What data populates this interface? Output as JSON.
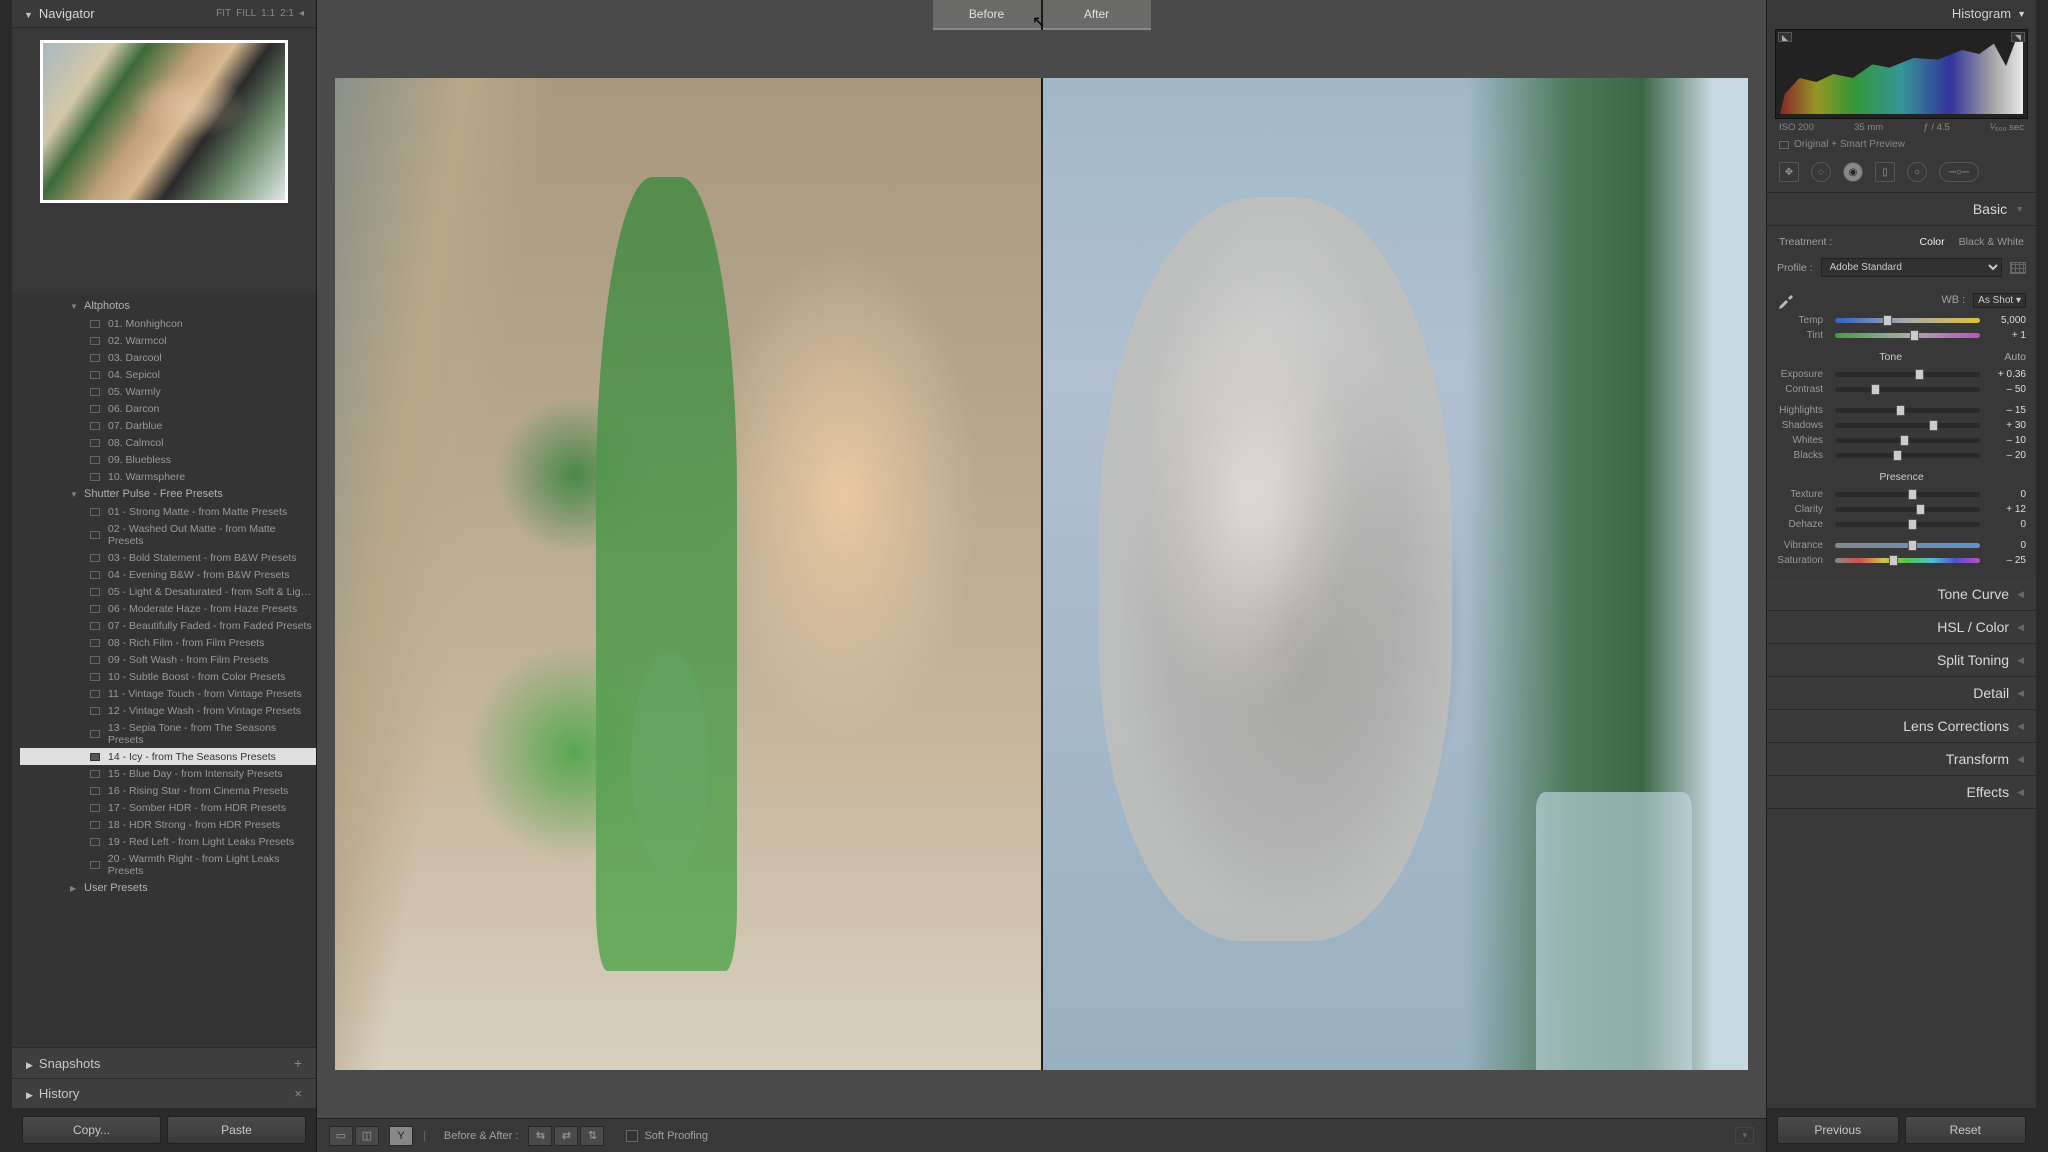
{
  "left": {
    "navigator": {
      "title": "Navigator",
      "zoom": [
        "FIT",
        "FILL",
        "1:1",
        "2:1"
      ]
    },
    "folders": [
      {
        "name": "Altphotos",
        "open": true,
        "presets": [
          "01. Monhighcon",
          "02. Warmcol",
          "03. Darcool",
          "04. Sepicol",
          "05. Warmly",
          "06. Darcon",
          "07. Darblue",
          "08. Calmcol",
          "09. Bluebless",
          "10. Warmsphere"
        ]
      },
      {
        "name": "Shutter Pulse - Free Presets",
        "open": true,
        "presets": [
          "01 - Strong Matte - from Matte Presets",
          "02 - Washed Out Matte - from Matte Presets",
          "03 - Bold Statement - from B&W Presets",
          "04 - Evening B&W - from B&W Presets",
          "05 - Light & Desaturated - from Soft & Lig…",
          "06 - Moderate Haze - from Haze Presets",
          "07 - Beautifully Faded - from Faded Presets",
          "08 - Rich Film - from Film Presets",
          "09 - Soft Wash - from Film Presets",
          "10 - Subtle Boost - from Color Presets",
          "11 - Vintage Touch - from Vintage Presets",
          "12 - Vintage Wash - from Vintage Presets",
          "13 - Sepia Tone - from The Seasons Presets",
          "14 - Icy - from The Seasons Presets",
          "15 - Blue Day - from Intensity Presets",
          "16 - Rising Star - from Cinema Presets",
          "17 - Somber HDR - from HDR Presets",
          "18 - HDR Strong - from HDR Presets",
          "19 - Red Left - from Light Leaks Presets",
          "20 - Warmth Right - from Light Leaks Presets"
        ]
      },
      {
        "name": "User Presets",
        "open": false,
        "presets": []
      }
    ],
    "selected_preset": "14 - Icy - from The Seasons Presets",
    "snapshots": "Snapshots",
    "history": "History",
    "copy": "Copy...",
    "paste": "Paste"
  },
  "center": {
    "before": "Before",
    "after": "After",
    "before_after_label": "Before & After :",
    "soft_proof": "Soft Proofing"
  },
  "right": {
    "histogram_title": "Histogram",
    "meta": {
      "iso": "ISO 200",
      "focal": "35 mm",
      "aperture": "ƒ / 4.5",
      "shutter": "¹⁄₅₀₀ sec"
    },
    "smart": "Original + Smart Preview",
    "basic_title": "Basic",
    "treatment_label": "Treatment :",
    "treatment_opts": [
      "Color",
      "Black & White"
    ],
    "profile_label": "Profile :",
    "profile_value": "Adobe Standard",
    "wb_label": "WB :",
    "wb_value": "As Shot",
    "sliders": {
      "temp": {
        "label": "Temp",
        "value": "5,000",
        "pos": 33
      },
      "tint": {
        "label": "Tint",
        "value": "+ 1",
        "pos": 52
      },
      "tone_head": "Tone",
      "auto": "Auto",
      "exposure": {
        "label": "Exposure",
        "value": "+ 0.36",
        "pos": 55
      },
      "contrast": {
        "label": "Contrast",
        "value": "– 50",
        "pos": 25
      },
      "highlights": {
        "label": "Highlights",
        "value": "– 15",
        "pos": 42
      },
      "shadows": {
        "label": "Shadows",
        "value": "+ 30",
        "pos": 65
      },
      "whites": {
        "label": "Whites",
        "value": "– 10",
        "pos": 45
      },
      "blacks": {
        "label": "Blacks",
        "value": "– 20",
        "pos": 40
      },
      "presence_head": "Presence",
      "texture": {
        "label": "Texture",
        "value": "0",
        "pos": 50
      },
      "clarity": {
        "label": "Clarity",
        "value": "+ 12",
        "pos": 56
      },
      "dehaze": {
        "label": "Dehaze",
        "value": "0",
        "pos": 50
      },
      "vibrance": {
        "label": "Vibrance",
        "value": "0",
        "pos": 50
      },
      "saturation": {
        "label": "Saturation",
        "value": "– 25",
        "pos": 37
      }
    },
    "collapsed": [
      "Tone Curve",
      "HSL / Color",
      "Split Toning",
      "Detail",
      "Lens Corrections",
      "Transform",
      "Effects"
    ],
    "previous": "Previous",
    "reset": "Reset"
  }
}
